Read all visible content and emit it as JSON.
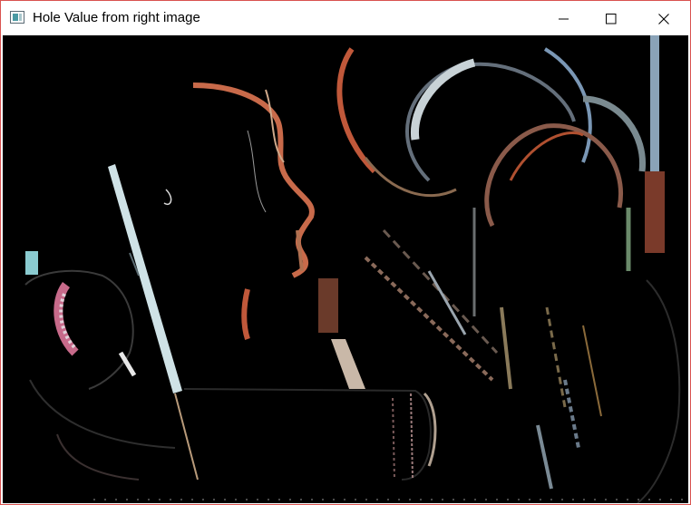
{
  "window": {
    "title": "Hole Value from right image",
    "border_color": "#d9534f"
  },
  "titlebar": {
    "app_icon": "opencv-window-icon",
    "controls": {
      "minimize_icon": "minimize-icon",
      "maximize_icon": "maximize-icon",
      "close_icon": "close-icon"
    }
  },
  "canvas": {
    "background": "#000000",
    "content": "disparity hole visualization image"
  }
}
